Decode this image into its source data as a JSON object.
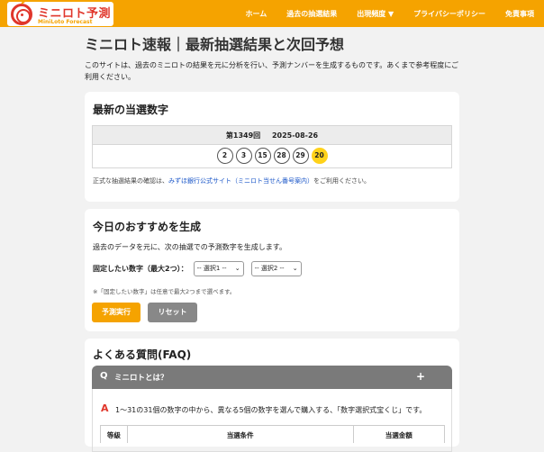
{
  "header": {
    "logo_title": "ミニロト予測",
    "logo_sub": "MiniLoto Forecast",
    "nav": [
      "ホーム",
      "過去の抽選結果",
      "出現頻度 ▼",
      "プライバシーポリシー",
      "免責事項"
    ]
  },
  "page_title": "ミニロト速報｜最新抽選結果と次回予想",
  "intro": "このサイトは、過去のミニロトの結果を元に分析を行い、予測ナンバーを生成するものです。あくまで参考程度にご利用ください。",
  "latest": {
    "heading": "最新の当選数字",
    "round": "第1349回",
    "date": "2025-08-26",
    "numbers": [
      "2",
      "3",
      "15",
      "28",
      "29"
    ],
    "bonus": "20",
    "note_prefix": "正式な抽選結果の確認は、",
    "note_link": "みずほ銀行公式サイト（ミニロト当せん番号案内）",
    "note_suffix": "をご利用ください。"
  },
  "generator": {
    "heading": "今日のおすすめを生成",
    "desc": "過去のデータを元に、次の抽選での予測数字を生成します。",
    "fix_label": "固定したい数字（最大2つ）：",
    "select1": "-- 選択1 --",
    "select2": "-- 選択2 --",
    "note": "※「固定したい数字」は任意で最大2つまで選べます。",
    "run_label": "予測実行",
    "reset_label": "リセット"
  },
  "faq": {
    "heading": "よくある質問(FAQ)",
    "q_mark": "Q",
    "question": "ミニロトとは？",
    "plus": "+",
    "a_mark": "A",
    "answer": "1〜31の31個の数字の中から、異なる5個の数字を選んで購入する、「数字選択式宝くじ」です。",
    "table_headers": [
      "等級",
      "当選条件",
      "当選金額"
    ]
  }
}
